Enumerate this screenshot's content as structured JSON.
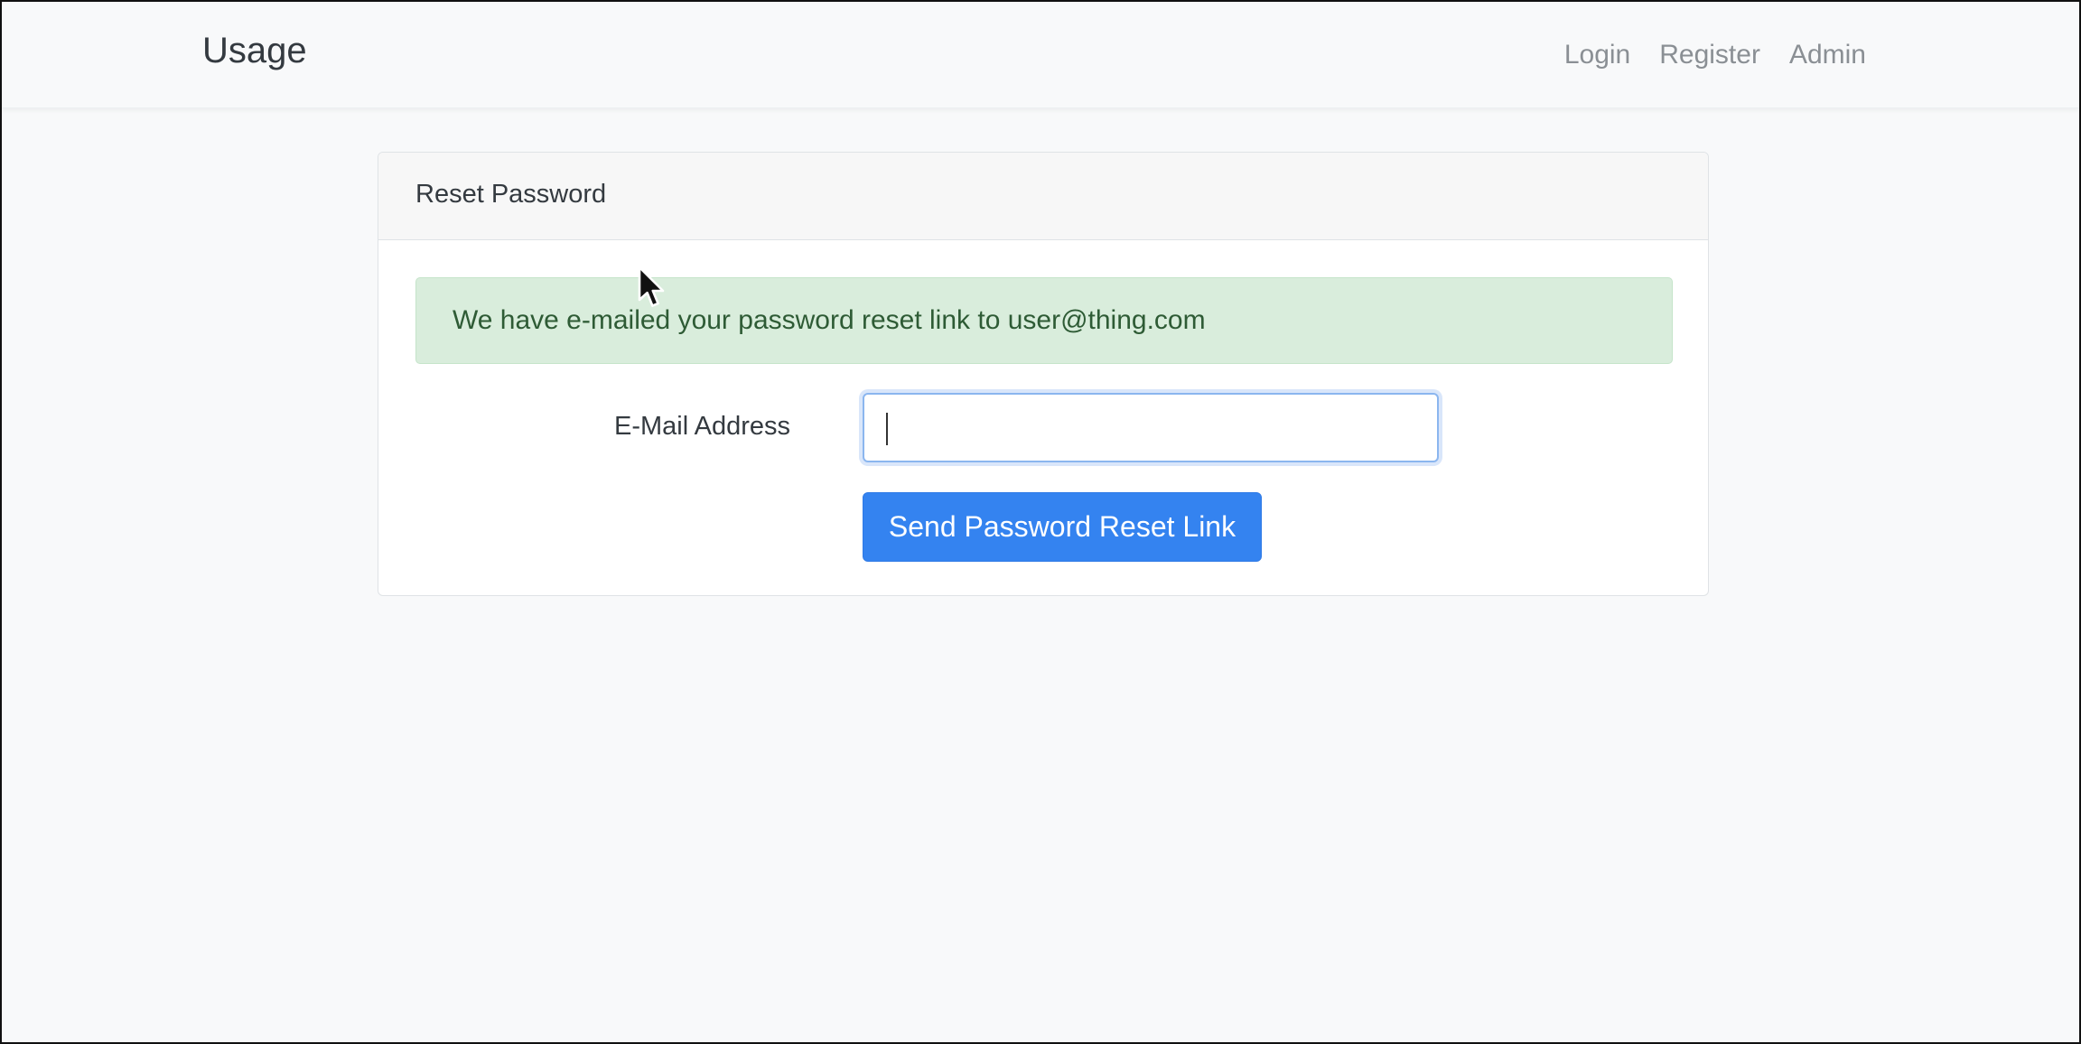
{
  "navbar": {
    "brand": "Usage",
    "links": [
      "Login",
      "Register",
      "Admin"
    ]
  },
  "card": {
    "title": "Reset Password"
  },
  "alert": {
    "message": "We have e-mailed your password reset link to user@thing.com"
  },
  "form": {
    "email_label": "E-Mail Address",
    "email_value": "",
    "submit_label": "Send Password Reset Link"
  },
  "colors": {
    "primary": "#3483f0",
    "success_bg": "#d9eddc",
    "success_text": "#2e5b35"
  },
  "icons": {
    "cursor": "mouse-pointer-icon"
  }
}
